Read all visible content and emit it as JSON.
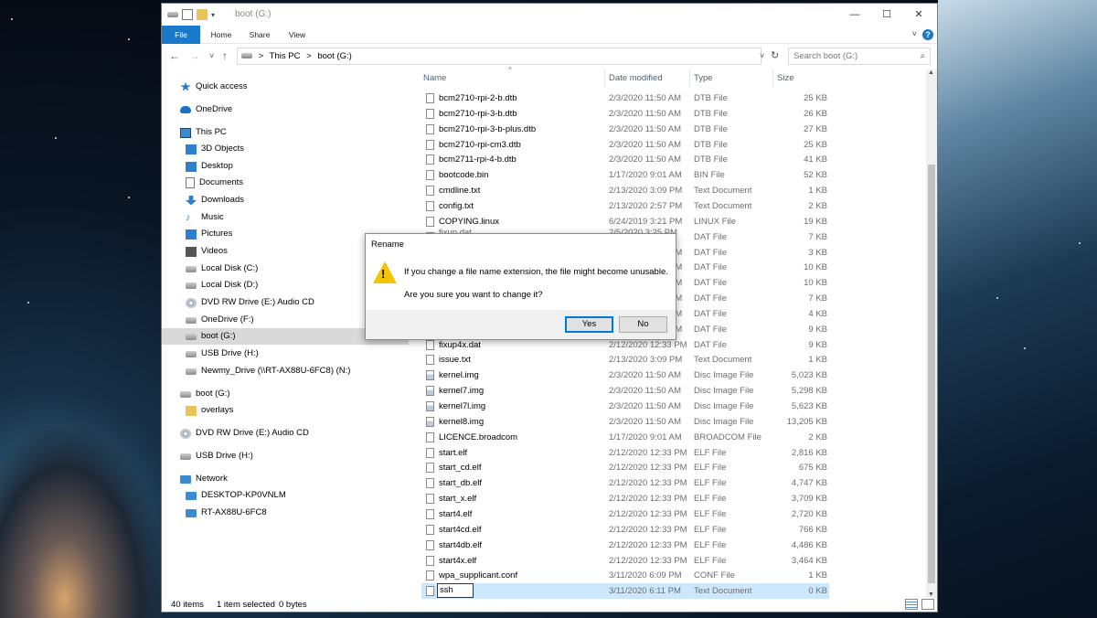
{
  "window": {
    "title": "boot (G:)",
    "minimize_glyph": "—",
    "maximize_glyph": "☐",
    "close_glyph": "✕"
  },
  "ribbon": {
    "tabs": [
      "File",
      "Home",
      "Share",
      "View"
    ],
    "help_glyph": "?",
    "expand_glyph": "˅"
  },
  "address": {
    "back_glyph": "←",
    "forward_glyph": "→",
    "recent_glyph": "˅",
    "up_glyph": "↑",
    "path": [
      "This PC",
      ">",
      "boot (G:)"
    ],
    "dropdown_glyph": "˅",
    "refresh_glyph": "↻",
    "search_placeholder": "Search boot (G:)",
    "search_glyph": "⌕"
  },
  "nav": {
    "items": [
      {
        "label": "Quick access",
        "icon": "star-icon"
      },
      {
        "label": "OneDrive",
        "icon": "cloud-icon"
      },
      {
        "label": "This PC",
        "icon": "pc-icon"
      },
      {
        "label": "3D Objects",
        "icon": "3d-objects-icon"
      },
      {
        "label": "Desktop",
        "icon": "desktop-icon"
      },
      {
        "label": "Documents",
        "icon": "documents-icon"
      },
      {
        "label": "Downloads",
        "icon": "downloads-icon"
      },
      {
        "label": "Music",
        "icon": "music-icon"
      },
      {
        "label": "Pictures",
        "icon": "pictures-icon"
      },
      {
        "label": "Videos",
        "icon": "videos-icon"
      },
      {
        "label": "Local Disk (C:)",
        "icon": "drive-icon"
      },
      {
        "label": "Local Disk (D:)",
        "icon": "drive-icon"
      },
      {
        "label": "DVD RW Drive (E:) Audio CD",
        "icon": "dvd-icon"
      },
      {
        "label": "OneDrive (F:)",
        "icon": "drive-icon"
      },
      {
        "label": "boot (G:)",
        "icon": "drive-icon"
      },
      {
        "label": "USB Drive (H:)",
        "icon": "drive-icon"
      },
      {
        "label": "Newmy_Drive (\\\\RT-AX88U-6FC8) (N:)",
        "icon": "network-drive-icon"
      },
      {
        "label": "boot (G:)",
        "icon": "drive-icon"
      },
      {
        "label": "overlays",
        "icon": "folder-icon"
      },
      {
        "label": "DVD RW Drive (E:) Audio CD",
        "icon": "dvd-icon"
      },
      {
        "label": "USB Drive (H:)",
        "icon": "drive-icon"
      },
      {
        "label": "Network",
        "icon": "network-icon"
      },
      {
        "label": "DESKTOP-KP0VNLM",
        "icon": "computer-icon"
      },
      {
        "label": "RT-AX88U-6FC8",
        "icon": "computer-icon"
      }
    ]
  },
  "columns": {
    "name": "Name",
    "date": "Date modified",
    "type": "Type",
    "size": "Size",
    "sort_glyph": "^"
  },
  "files": [
    {
      "name": "bcm2710-rpi-2-b.dtb",
      "date": "2/3/2020 11:50 AM",
      "type": "DTB File",
      "size": "25 KB"
    },
    {
      "name": "bcm2710-rpi-3-b.dtb",
      "date": "2/3/2020 11:50 AM",
      "type": "DTB File",
      "size": "26 KB"
    },
    {
      "name": "bcm2710-rpi-3-b-plus.dtb",
      "date": "2/3/2020 11:50 AM",
      "type": "DTB File",
      "size": "27 KB"
    },
    {
      "name": "bcm2710-rpi-cm3.dtb",
      "date": "2/3/2020 11:50 AM",
      "type": "DTB File",
      "size": "25 KB"
    },
    {
      "name": "bcm2711-rpi-4-b.dtb",
      "date": "2/3/2020 11:50 AM",
      "type": "DTB File",
      "size": "41 KB"
    },
    {
      "name": "bootcode.bin",
      "date": "1/17/2020 9:01 AM",
      "type": "BIN File",
      "size": "52 KB"
    },
    {
      "name": "cmdline.txt",
      "date": "2/13/2020 3:09 PM",
      "type": "Text Document",
      "size": "1 KB"
    },
    {
      "name": "config.txt",
      "date": "2/13/2020 2:57 PM",
      "type": "Text Document",
      "size": "2 KB"
    },
    {
      "name": "COPYING.linux",
      "date": "6/24/2019 3:21 PM",
      "type": "LINUX File",
      "size": "19 KB"
    },
    {
      "name": "",
      "date": "",
      "type": "DAT File",
      "size": "7 KB"
    },
    {
      "name": "",
      "date": "",
      "type": "DAT File",
      "size": "3 KB"
    },
    {
      "name": "",
      "date": "",
      "type": "DAT File",
      "size": "10 KB"
    },
    {
      "name": "",
      "date": "",
      "type": "DAT File",
      "size": "10 KB"
    },
    {
      "name": "",
      "date": "",
      "type": "DAT File",
      "size": "7 KB"
    },
    {
      "name": "",
      "date": "",
      "type": "DAT File",
      "size": "4 KB"
    },
    {
      "name": "",
      "date": "",
      "type": "DAT File",
      "size": "9 KB"
    },
    {
      "name": "fixup4x.dat",
      "date": "2/12/2020 12:33 PM",
      "type": "DAT File",
      "size": "9 KB"
    },
    {
      "name": "issue.txt",
      "date": "2/13/2020 3:09 PM",
      "type": "Text Document",
      "size": "1 KB"
    },
    {
      "name": "kernel.img",
      "date": "2/3/2020 11:50 AM",
      "type": "Disc Image File",
      "size": "5,023 KB"
    },
    {
      "name": "kernel7.img",
      "date": "2/3/2020 11:50 AM",
      "type": "Disc Image File",
      "size": "5,298 KB"
    },
    {
      "name": "kernel7l.img",
      "date": "2/3/2020 11:50 AM",
      "type": "Disc Image File",
      "size": "5,623 KB"
    },
    {
      "name": "kernel8.img",
      "date": "2/3/2020 11:50 AM",
      "type": "Disc Image File",
      "size": "13,205 KB"
    },
    {
      "name": "LICENCE.broadcom",
      "date": "1/17/2020 9:01 AM",
      "type": "BROADCOM File",
      "size": "2 KB"
    },
    {
      "name": "start.elf",
      "date": "2/12/2020 12:33 PM",
      "type": "ELF File",
      "size": "2,816 KB"
    },
    {
      "name": "start_cd.elf",
      "date": "2/12/2020 12:33 PM",
      "type": "ELF File",
      "size": "675 KB"
    },
    {
      "name": "start_db.elf",
      "date": "2/12/2020 12:33 PM",
      "type": "ELF File",
      "size": "4,747 KB"
    },
    {
      "name": "start_x.elf",
      "date": "2/12/2020 12:33 PM",
      "type": "ELF File",
      "size": "3,709 KB"
    },
    {
      "name": "start4.elf",
      "date": "2/12/2020 12:33 PM",
      "type": "ELF File",
      "size": "2,720 KB"
    },
    {
      "name": "start4cd.elf",
      "date": "2/12/2020 12:33 PM",
      "type": "ELF File",
      "size": "766 KB"
    },
    {
      "name": "start4db.elf",
      "date": "2/12/2020 12:33 PM",
      "type": "ELF File",
      "size": "4,486 KB"
    },
    {
      "name": "start4x.elf",
      "date": "2/12/2020 12:33 PM",
      "type": "ELF File",
      "size": "3,464 KB"
    },
    {
      "name": "wpa_supplicant.conf",
      "date": "3/11/2020 6:09 PM",
      "type": "CONF File",
      "size": "1 KB"
    },
    {
      "name": "ssh",
      "date": "3/11/2020 6:11 PM",
      "type": "Text Document",
      "size": "0 KB",
      "selected": true,
      "renaming": true
    }
  ],
  "partially_hidden_rows": {
    "fixup_name": "fixup.dat",
    "fixup_date": "2/5/2020 3:25 PM",
    "am_fragment": "AM",
    "pm_fragment": "PM"
  },
  "dialog": {
    "title": "Rename",
    "message1": "If you change a file name extension, the file might become unusable.",
    "message2": "Are you sure you want to change it?",
    "warning_glyph": "!",
    "yes_label": "Yes",
    "no_label": "No"
  },
  "status": {
    "item_count": "40 items",
    "selection": "1 item selected",
    "selection_size": "0 bytes"
  },
  "scroll": {
    "up_glyph": "▲",
    "down_glyph": "▼"
  },
  "colors": {
    "accent": "#1979ca",
    "selection": "#cce8ff",
    "warning": "#f4c400"
  }
}
